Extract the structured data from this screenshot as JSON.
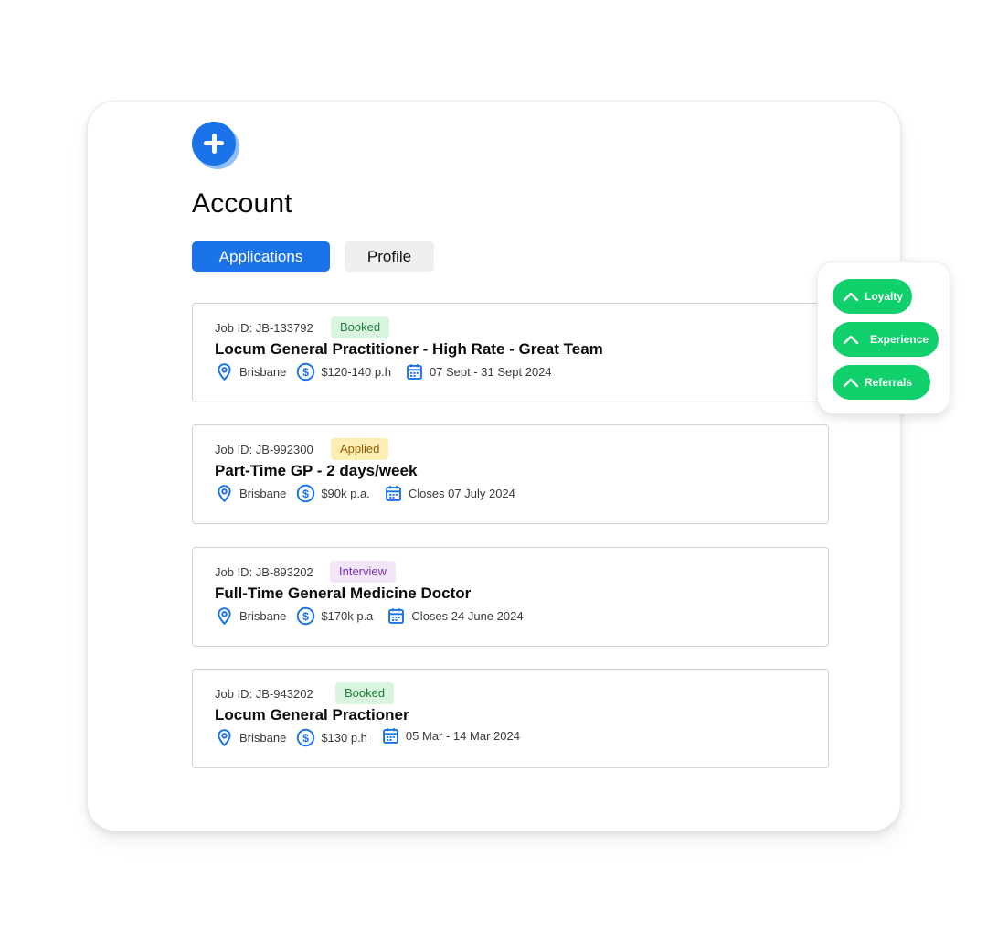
{
  "page": {
    "title": "Account"
  },
  "tabs": [
    {
      "label": "Applications",
      "active": true
    },
    {
      "label": "Profile",
      "active": false
    }
  ],
  "jobs": [
    {
      "id_label": "Job ID: JB-133792",
      "status": "Booked",
      "title": "Locum General Practitioner - High Rate - Great Team",
      "location": "Brisbane",
      "rate": "$120-140 p.h",
      "date": "07 Sept - 31 Sept 2024"
    },
    {
      "id_label": "Job ID: JB-992300",
      "status": "Applied",
      "title": "Part-Time GP - 2 days/week",
      "location": "Brisbane",
      "rate": "$90k p.a.",
      "date": "Closes 07 July 2024"
    },
    {
      "id_label": "Job ID: JB-893202",
      "status": "Interview",
      "title": "Full-Time General Medicine Doctor",
      "location": "Brisbane",
      "rate": "$170k p.a",
      "date": "Closes 24 June 2024"
    },
    {
      "id_label": "Job ID: JB-943202",
      "status": "Booked",
      "title": "Locum General Practioner",
      "location": "Brisbane",
      "rate": "$130 p.h",
      "date": "05 Mar - 14 Mar 2024"
    }
  ],
  "floating_panel": {
    "pills": [
      {
        "label": "Loyalty",
        "icon": "chevron-up-icon"
      },
      {
        "label": "Experience",
        "icon": "chevron-up-icon"
      },
      {
        "label": "Referrals",
        "icon": "chevron-up-icon"
      }
    ]
  },
  "icons": {
    "logo": "plus-icon",
    "location": "map-pin-icon",
    "rate": "dollar-circle-icon",
    "date": "calendar-icon"
  },
  "colors": {
    "primary": "#1a73e8",
    "pill_green": "#10d06b",
    "badge_booked_bg": "#d9f5e0",
    "badge_booked_text": "#1e7d3a",
    "badge_applied_bg": "#fcefb6",
    "badge_applied_text": "#9a5b00",
    "badge_interview_bg": "#f3e6fb",
    "badge_interview_text": "#7b2fb4"
  }
}
